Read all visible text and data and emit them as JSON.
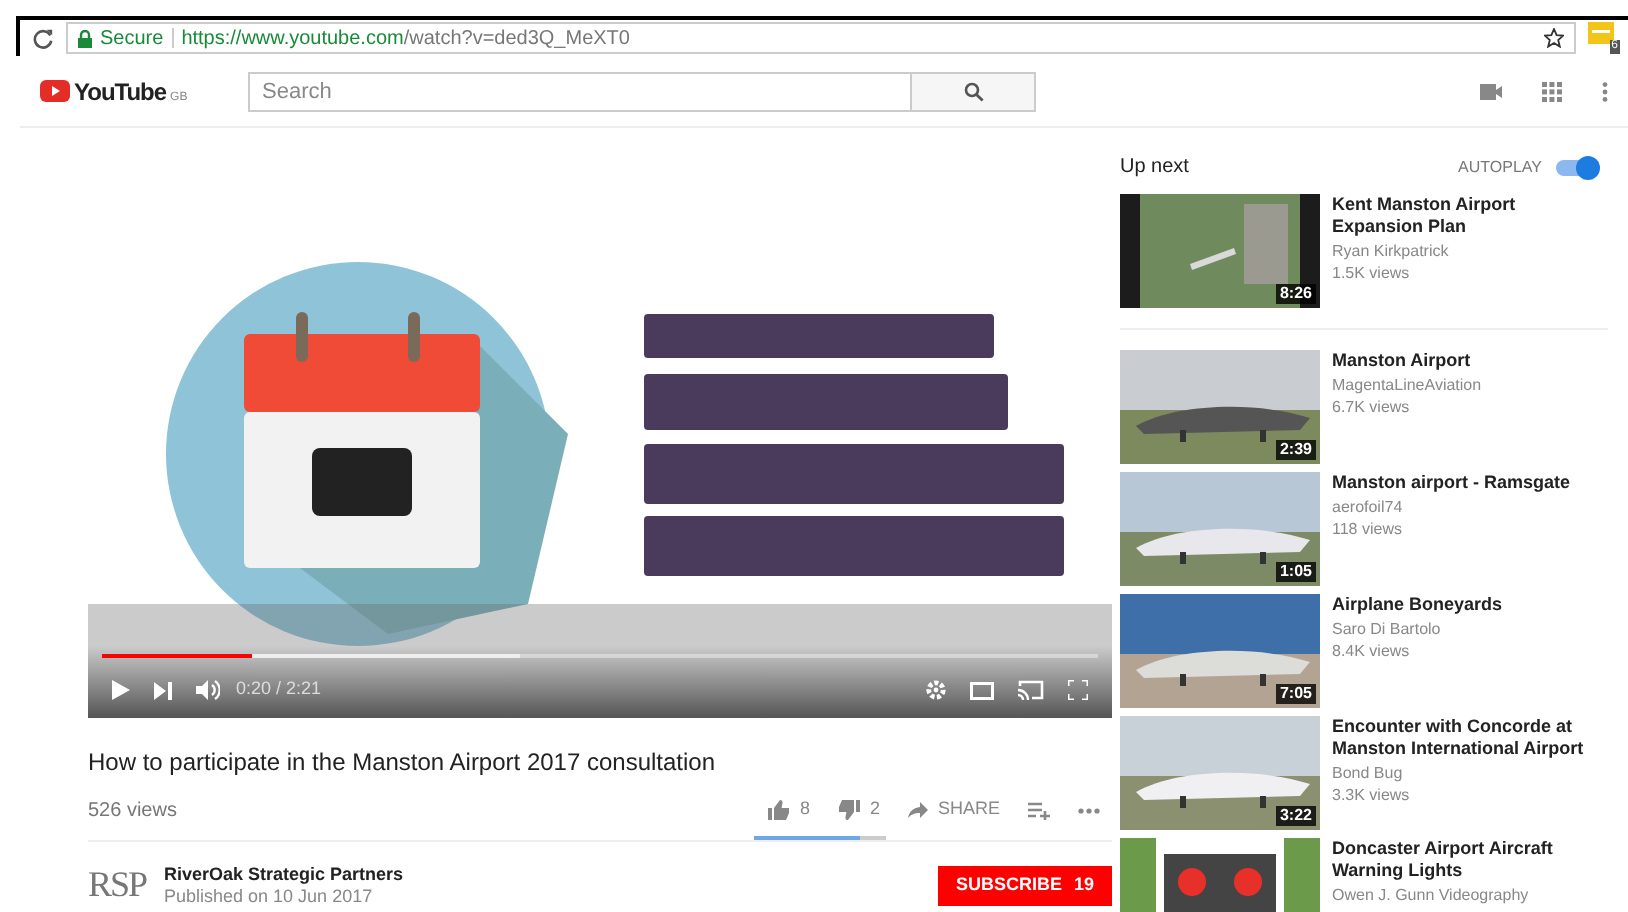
{
  "browser": {
    "secure_label": "Secure",
    "url_host": "https://www.youtube.com",
    "url_path": "/watch?v=ded3Q_MeXT0",
    "extension_badge": "6"
  },
  "header": {
    "logo_text": "YouTube",
    "region": "GB",
    "search_placeholder": "Search"
  },
  "player": {
    "progress": {
      "level": 0.15
    },
    "buffered": {
      "level": 0.42
    },
    "time": "0:20 / 2:21"
  },
  "video": {
    "title": "How to participate in the Manston Airport 2017 consultation",
    "views": "526 views",
    "likes": "8",
    "dislikes": "2",
    "share": "SHARE",
    "like_ratio": {
      "level": 0.8
    }
  },
  "channel": {
    "logo": "RSP",
    "name": "RiverOak Strategic Partners",
    "published": "Published on 10 Jun 2017",
    "subscribe": "SUBSCRIBE",
    "subscribers": "19"
  },
  "sidebar": {
    "heading": "Up next",
    "autoplay": {
      "label": "AUTOPLAY",
      "on": true
    },
    "videos": [
      {
        "title": "Kent Manston Airport Expansion Plan",
        "channel": "Ryan Kirkpatrick",
        "views": "1.5K views",
        "duration": "8:26"
      },
      {
        "title": "Manston Airport",
        "channel": "MagentaLineAviation",
        "views": "6.7K views",
        "duration": "2:39"
      },
      {
        "title": "Manston airport - Ramsgate",
        "channel": "aerofoil74",
        "views": "118 views",
        "duration": "1:05"
      },
      {
        "title": "Airplane Boneyards",
        "channel": "Saro Di Bartolo",
        "views": "8.4K views",
        "duration": "7:05"
      },
      {
        "title": "Encounter with Concorde at Manston International Airport",
        "channel": "Bond Bug",
        "views": "3.3K views",
        "duration": "3:22"
      },
      {
        "title": "Doncaster Airport Aircraft Warning Lights",
        "channel": "Owen J. Gunn Videography"
      }
    ]
  }
}
